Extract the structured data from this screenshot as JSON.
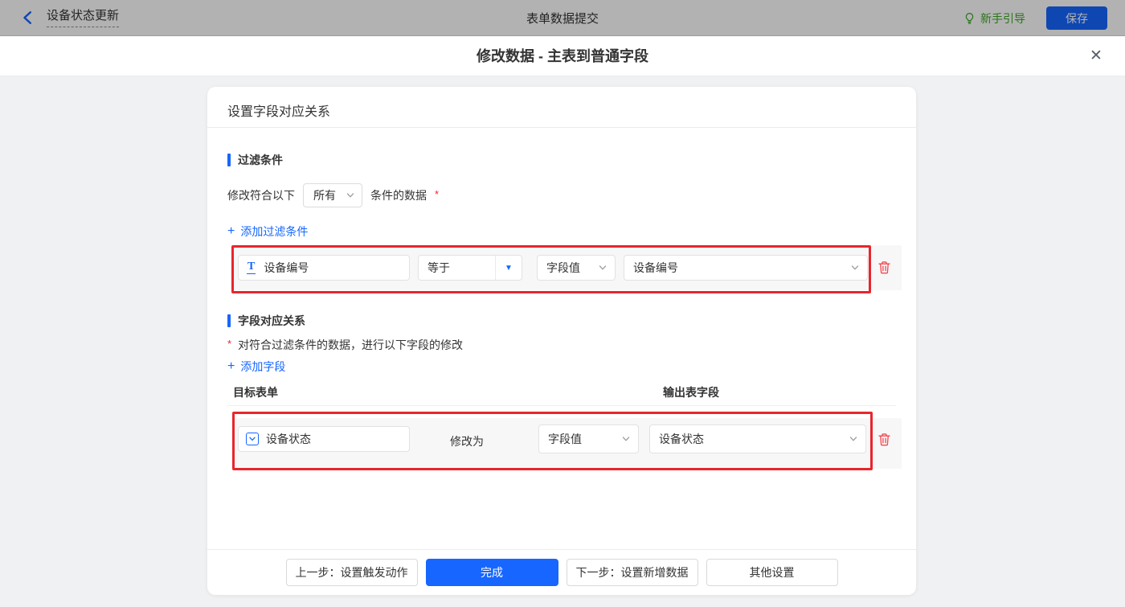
{
  "topbar": {
    "back_title": "设备状态更新",
    "center_title": "表单数据提交",
    "guide_label": "新手引导",
    "save_label": "保存"
  },
  "dialog": {
    "title": "修改数据 - 主表到普通字段"
  },
  "panel": {
    "header": "设置字段对应关系",
    "filter": {
      "title": "过滤条件",
      "match_prefix": "修改符合以下",
      "match_select_value": "所有",
      "match_suffix": "条件的数据",
      "required_mark": "*",
      "add_link": "添加过滤条件",
      "row": {
        "field": "设备编号",
        "operator": "等于",
        "value_type": "字段值",
        "value_field": "设备编号"
      }
    },
    "mapping": {
      "title": "字段对应关系",
      "required_mark": "*",
      "description": "对符合过滤条件的数据，进行以下字段的修改",
      "add_link": "添加字段",
      "col_left": "目标表单",
      "col_right": "输出表字段",
      "row": {
        "target_field": "设备状态",
        "action_label": "修改为",
        "value_type": "字段值",
        "value_field": "设备状态"
      }
    }
  },
  "footer": {
    "prev": "上一步：设置触发动作",
    "done": "完成",
    "next": "下一步：设置新增数据",
    "other": "其他设置"
  },
  "icons": {
    "plus": "+",
    "close": "✕",
    "caret_down": "▼",
    "text_field_glyph": "T"
  },
  "colors": {
    "accent_blue": "#1666ff",
    "annotation_red": "#e8262d",
    "trash_red": "#f2494f",
    "guide_green": "#3da824",
    "row_background": "#f7f7f8",
    "topbar_dim": "rgba(0,0,0,0.30)"
  }
}
